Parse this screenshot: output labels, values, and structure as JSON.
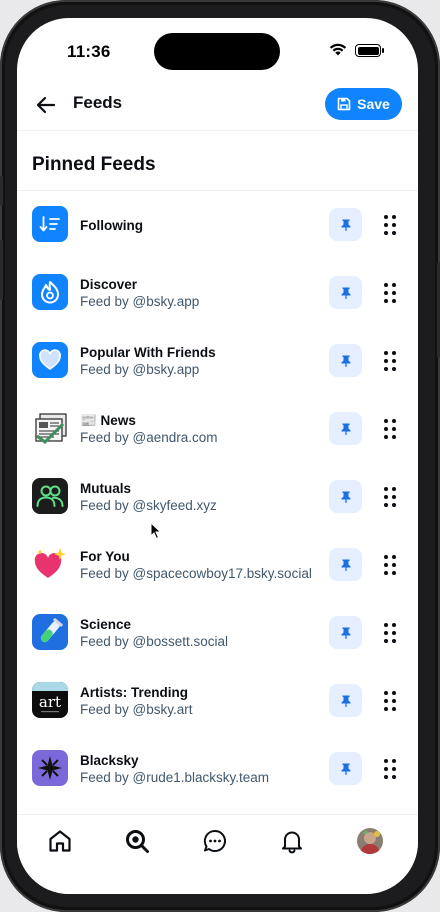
{
  "status_bar": {
    "time": "11:36"
  },
  "header": {
    "title": "Feeds",
    "save_label": "Save",
    "back_icon": "arrow-left-icon"
  },
  "section": {
    "title": "Pinned Feeds"
  },
  "colors": {
    "accent": "#1083fe",
    "pin_bg": "#e5efff",
    "pin_icon": "#1a6fe6",
    "subtext": "#42576c"
  },
  "feeds": [
    {
      "name": "Following",
      "sub": "",
      "icon": "following-sort-icon"
    },
    {
      "name": "Discover",
      "sub": "Feed by @bsky.app",
      "icon": "discover-flame-icon"
    },
    {
      "name": "Popular With Friends",
      "sub": "Feed by @bsky.app",
      "icon": "heart-icon"
    },
    {
      "name": "📰 News",
      "sub": "Feed by @aendra.com",
      "icon": "news-icon"
    },
    {
      "name": "Mutuals",
      "sub": "Feed by @skyfeed.xyz",
      "icon": "mutuals-people-icon"
    },
    {
      "name": "For You",
      "sub": "Feed by @spacecowboy17.bsky.social",
      "icon": "sparkle-heart-icon"
    },
    {
      "name": "Science",
      "sub": "Feed by @bossett.social",
      "icon": "test-tube-icon"
    },
    {
      "name": "Artists: Trending",
      "sub": "Feed by @bsky.art",
      "icon": "art-logo-icon"
    },
    {
      "name": "Blacksky",
      "sub": "Feed by @rude1.blacksky.team",
      "icon": "blacksky-star-icon"
    }
  ],
  "tabbar": {
    "items": [
      "home-icon",
      "search-icon",
      "messages-icon",
      "notifications-icon",
      "profile-avatar"
    ]
  }
}
